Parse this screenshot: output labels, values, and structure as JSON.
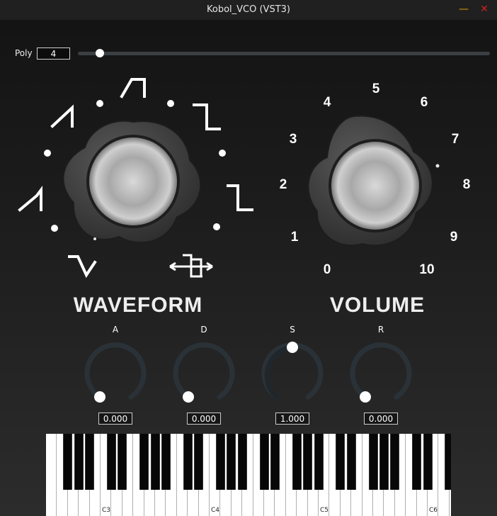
{
  "window": {
    "title": "Kobol_VCO (VST3)",
    "minimize_icon": "minimize-icon",
    "close_icon": "close-icon"
  },
  "poly": {
    "label": "Poly",
    "value": "4",
    "slider_fraction": 0.04
  },
  "waveform": {
    "label": "WAVEFORM",
    "symbols": [
      "sawtooth-down-icon",
      "sawtooth-up-icon",
      "pulse-icon",
      "square-icon",
      "square-wide-icon",
      "pwm-icon",
      "triangle-icon"
    ]
  },
  "volume": {
    "label": "VOLUME",
    "scale": [
      "0",
      "1",
      "2",
      "3",
      "4",
      "5",
      "6",
      "7",
      "8",
      "9",
      "10"
    ]
  },
  "adsr": [
    {
      "label": "A",
      "value": "0.000",
      "fraction": 0.0
    },
    {
      "label": "D",
      "value": "0.000",
      "fraction": 0.0
    },
    {
      "label": "S",
      "value": "1.000",
      "fraction": 0.5
    },
    {
      "label": "R",
      "value": "0.000",
      "fraction": 0.0
    }
  ],
  "keyboard": {
    "labels": [
      "C3",
      "C4",
      "C5",
      "C6"
    ]
  }
}
